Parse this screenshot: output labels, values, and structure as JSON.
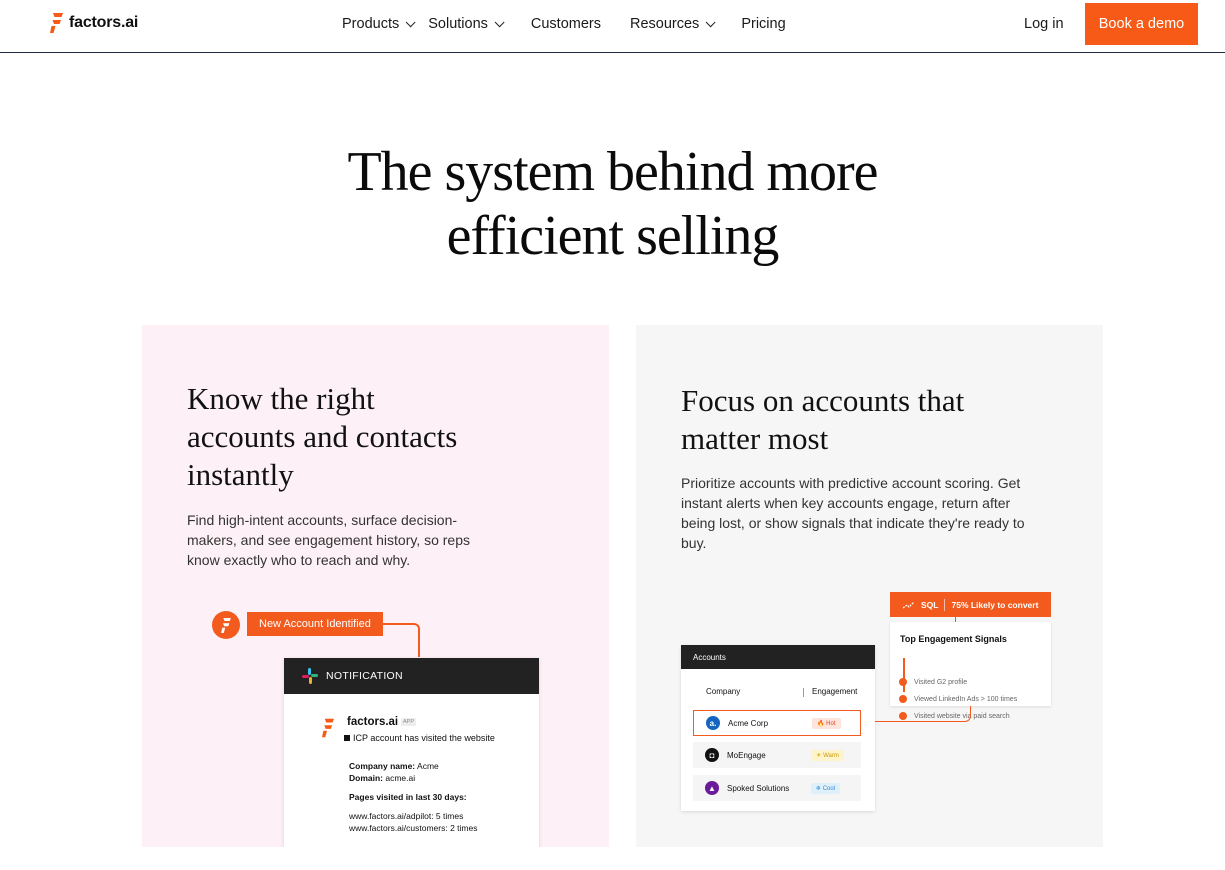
{
  "nav": {
    "brand": "factors.ai",
    "menu": [
      {
        "label": "Products",
        "dropdown": true
      },
      {
        "label": "Solutions",
        "dropdown": true
      },
      {
        "label": "Customers",
        "dropdown": false
      },
      {
        "label": "Resources",
        "dropdown": true
      },
      {
        "label": "Pricing",
        "dropdown": false
      }
    ],
    "login": "Log in",
    "cta": "Book a demo"
  },
  "hero": {
    "line1": "The system behind more",
    "line2": "efficient selling"
  },
  "card_left": {
    "title_l1": "Know the right",
    "title_l2": "accounts and contacts",
    "title_l3": "instantly",
    "desc_l1": "Find high-intent accounts, surface decision-",
    "desc_l2": "makers, and see engagement history, so reps",
    "desc_l3": "know exactly who to reach and why.",
    "tag": "New Account Identified",
    "notification": {
      "header": "NOTIFICATION",
      "brand": "factors.ai",
      "app_badge": "APP",
      "message": "ICP account has visited the website",
      "company_label": "Company name:",
      "company_value": "Acme",
      "domain_label": "Domain:",
      "domain_value": "acme.ai",
      "pages_label": "Pages visited in last 30 days:",
      "page1": "www.factors.ai/adpilot: 5 times",
      "page2": "www.factors.ai/customers: 2 times"
    }
  },
  "card_right": {
    "title_l1": "Focus on accounts that",
    "title_l2": "matter most",
    "desc_l1": "Prioritize accounts with predictive account scoring. Get",
    "desc_l2": "instant alerts when key accounts engage, return after",
    "desc_l3": "being lost, or show signals that indicate they're ready to",
    "desc_l4": "buy.",
    "sql_tag": "SQL",
    "sql_likely": "75% Likely to convert",
    "signals_title": "Top Engagement Signals",
    "signals": [
      "Visited G2 profile",
      "Viewed LinkedIn Ads > 100 times",
      "Visited website via paid search"
    ],
    "accounts_header": "Accounts",
    "col_company": "Company",
    "col_engagement": "Engagement",
    "rows": [
      {
        "name": "Acme Corp",
        "badge": "Hot",
        "badge_icon": "flame-icon",
        "color": "#1565c0"
      },
      {
        "name": "MoEngage",
        "badge": "Warm",
        "badge_icon": "sun-icon",
        "color": "#111111"
      },
      {
        "name": "Spoked Solutions",
        "badge": "Cool",
        "badge_icon": "snowflake-icon",
        "color": "#6a1b9a"
      }
    ]
  },
  "colors": {
    "accent": "#f75a16",
    "left_card_bg": "#fdf0f6",
    "right_card_bg": "#f6f6f6"
  }
}
